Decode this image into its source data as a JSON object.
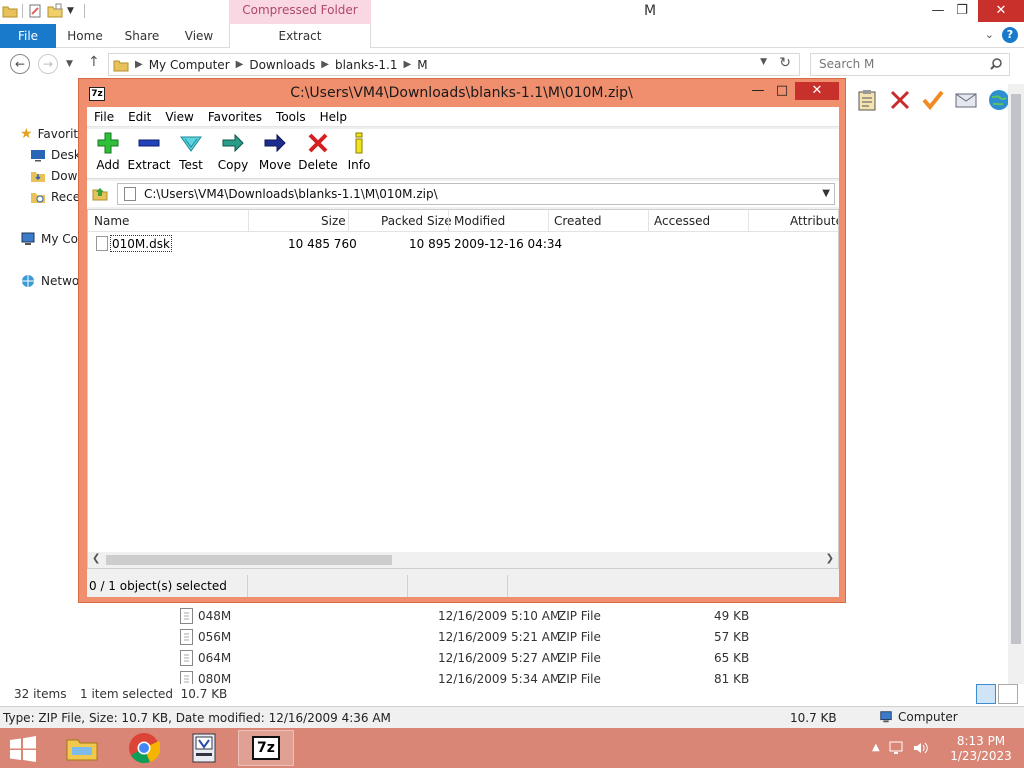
{
  "explorer": {
    "contextual_tab": "Compressed Folder Tools",
    "window_title": "M",
    "ribbon_tabs": [
      "File",
      "Home",
      "Share",
      "View",
      "Extract"
    ],
    "breadcrumb": [
      "My Computer",
      "Downloads",
      "blanks-1.1",
      "M"
    ],
    "search_placeholder": "Search M",
    "nav_items": [
      "Favorites",
      "Desktop",
      "Downloads",
      "Recent places",
      "My Computer",
      "Network"
    ],
    "files": [
      {
        "name": "048M",
        "date": "12/16/2009 5:10 AM",
        "type": "ZIP File",
        "size": "49 KB"
      },
      {
        "name": "056M",
        "date": "12/16/2009 5:21 AM",
        "type": "ZIP File",
        "size": "57 KB"
      },
      {
        "name": "064M",
        "date": "12/16/2009 5:27 AM",
        "type": "ZIP File",
        "size": "65 KB"
      },
      {
        "name": "080M",
        "date": "12/16/2009 5:34 AM",
        "type": "ZIP File",
        "size": "81 KB"
      }
    ],
    "status_items": "32 items",
    "status_selected": "1 item selected  10.7 KB",
    "details_text": "Type: ZIP File, Size: 10.7 KB, Date modified: 12/16/2009 4:36 AM",
    "details_size": "10.7 KB",
    "details_location": "Computer"
  },
  "zip": {
    "title": "C:\\Users\\VM4\\Downloads\\blanks-1.1\\M\\010M.zip\\",
    "menu": [
      "File",
      "Edit",
      "View",
      "Favorites",
      "Tools",
      "Help"
    ],
    "toolbar": [
      "Add",
      "Extract",
      "Test",
      "Copy",
      "Move",
      "Delete",
      "Info"
    ],
    "path": "C:\\Users\\VM4\\Downloads\\blanks-1.1\\M\\010M.zip\\",
    "columns": [
      "Name",
      "Size",
      "Packed Size",
      "Modified",
      "Created",
      "Accessed",
      "Attributes"
    ],
    "rows": [
      {
        "name": "010M.dsk",
        "size": "10 485 760",
        "packed": "10 895",
        "modified": "2009-12-16 04:34"
      }
    ],
    "status": "0 / 1 object(s) selected"
  },
  "taskbar": {
    "apps": [
      "File Explorer",
      "Google Chrome",
      "Virtual machine app",
      "7-Zip"
    ],
    "time": "8:13 PM",
    "date": "1/23/2023"
  }
}
